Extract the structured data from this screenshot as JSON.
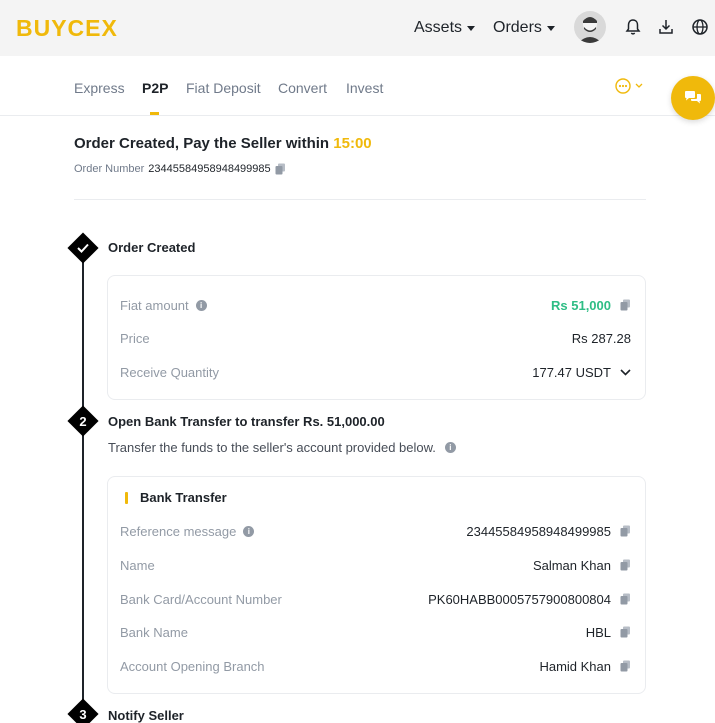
{
  "header": {
    "logo_main": "BUYCE",
    "logo_x": "X",
    "nav": [
      {
        "label": "Assets"
      },
      {
        "label": "Orders"
      }
    ],
    "icons": [
      "avatar",
      "bell-icon",
      "download-icon",
      "globe-icon"
    ]
  },
  "tabs": [
    {
      "label": "Express"
    },
    {
      "label": "P2P"
    },
    {
      "label": "Fiat Deposit"
    },
    {
      "label": "Convert"
    },
    {
      "label": "Invest"
    }
  ],
  "order": {
    "title": "Order Created, Pay the Seller within",
    "timer": "15:00",
    "number_label": "Order Number",
    "number": "23445584958948499985"
  },
  "steps": {
    "s1": {
      "title": "Order Created"
    },
    "s2": {
      "num": "2",
      "title": "Open Bank Transfer to transfer Rs. 51,000.00",
      "subtitle": "Transfer the funds to the seller's account provided below."
    },
    "s3": {
      "num": "3",
      "title": "Notify Seller"
    }
  },
  "summary": {
    "fiat_label": "Fiat amount",
    "fiat_value": "Rs 51,000",
    "price_label": "Price",
    "price_value": "Rs 287.28",
    "qty_label": "Receive Quantity",
    "qty_value": "177.47 USDT"
  },
  "bank": {
    "heading": "Bank Transfer",
    "ref_label": "Reference message",
    "ref_value": "23445584958948499985",
    "name_label": "Name",
    "name_value": "Salman Khan",
    "acct_label": "Bank Card/Account Number",
    "acct_value": "PK60HABB0005757900800804",
    "bankname_label": "Bank Name",
    "bankname_value": "HBL",
    "branch_label": "Account Opening Branch",
    "branch_value": "Hamid Khan"
  },
  "colors": {
    "accent": "#f0b90b",
    "positive": "#2ebd85",
    "text": "#1e2329",
    "muted": "#929aa5"
  }
}
